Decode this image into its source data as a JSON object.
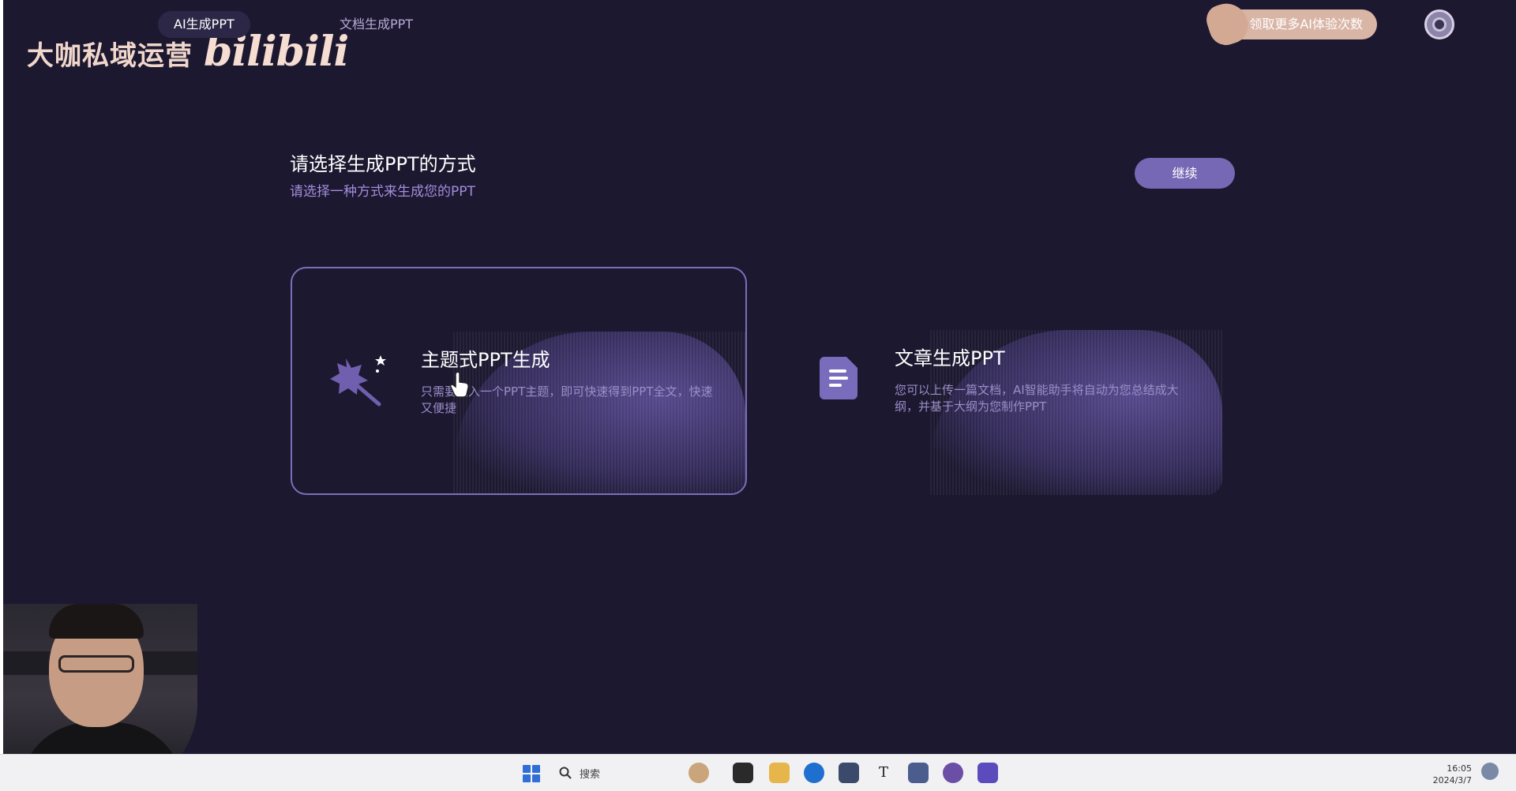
{
  "header": {
    "brand_text": "大咖私域运营",
    "brand_logo": "bilibili",
    "tabs": [
      {
        "label": "AI生成PPT",
        "active": true
      },
      {
        "label": "文档生成PPT",
        "active": false
      }
    ],
    "promo_label": "领取更多AI体验次数",
    "avatar_icon": "avatar-icon"
  },
  "main": {
    "title": "请选择生成PPT的方式",
    "subtitle": "请选择一种方式来生成您的PPT",
    "continue_label": "继续",
    "options": [
      {
        "title": "主题式PPT生成",
        "description": "只需要输入一个PPT主题，即可快速得到PPT全文，快速又便捷",
        "icon": "magic-wand-icon",
        "selected": true
      },
      {
        "title": "文章生成PPT",
        "description": "您可以上传一篇文档，AI智能助手将自动为您总结成大纲，并基于大纲为您制作PPT",
        "icon": "document-icon",
        "selected": false
      }
    ]
  },
  "taskbar": {
    "search_label": "搜索",
    "time": "16:05",
    "date": "2024/3/7"
  },
  "colors": {
    "background": "#1c1830",
    "accent": "#7668b4",
    "promo": "#d9b5a6",
    "subtitle": "#a48ddb"
  }
}
